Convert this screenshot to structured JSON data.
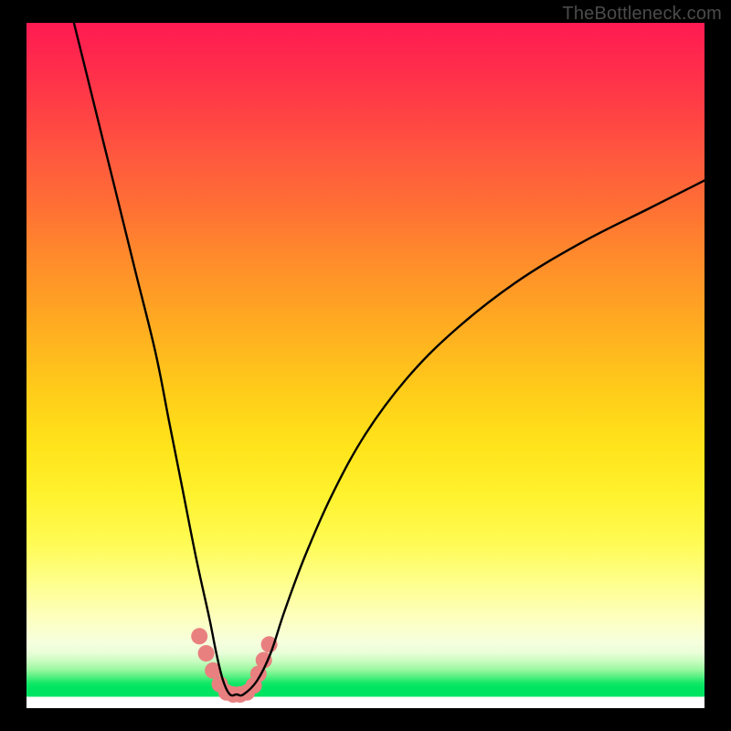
{
  "watermark": "TheBottleneck.com",
  "colors": {
    "background": "#000000",
    "curve_stroke": "#000000",
    "marker_fill": "#e98080",
    "gradient_top": "#ff1a52",
    "gradient_mid": "#ffe41b",
    "gradient_green": "#00e461"
  },
  "chart_data": {
    "type": "line",
    "title": "",
    "xlabel": "",
    "ylabel": "",
    "xlim": [
      0,
      100
    ],
    "ylim": [
      0,
      100
    ],
    "series": [
      {
        "name": "bottleneck-curve",
        "x": [
          7,
          10,
          13,
          16,
          19,
          21,
          23,
          25,
          27,
          28,
          29,
          30,
          31,
          32,
          34,
          36,
          38,
          41,
          45,
          50,
          56,
          63,
          72,
          82,
          92,
          100
        ],
        "y": [
          100,
          88,
          76,
          64,
          52,
          42,
          32,
          22,
          13,
          8,
          4,
          2,
          2,
          2,
          4,
          8,
          14,
          22,
          31,
          40,
          48,
          55,
          62,
          68,
          73,
          77
        ]
      }
    ],
    "markers": {
      "name": "highlight-points",
      "x": [
        25.5,
        26.5,
        27.5,
        28.5,
        29.5,
        30.5,
        31.5,
        32.5,
        33.5,
        34.2,
        35.0,
        35.8
      ],
      "y": [
        10.5,
        8.0,
        5.5,
        3.5,
        2.3,
        2.0,
        2.0,
        2.3,
        3.3,
        5.0,
        7.0,
        9.3
      ]
    }
  }
}
